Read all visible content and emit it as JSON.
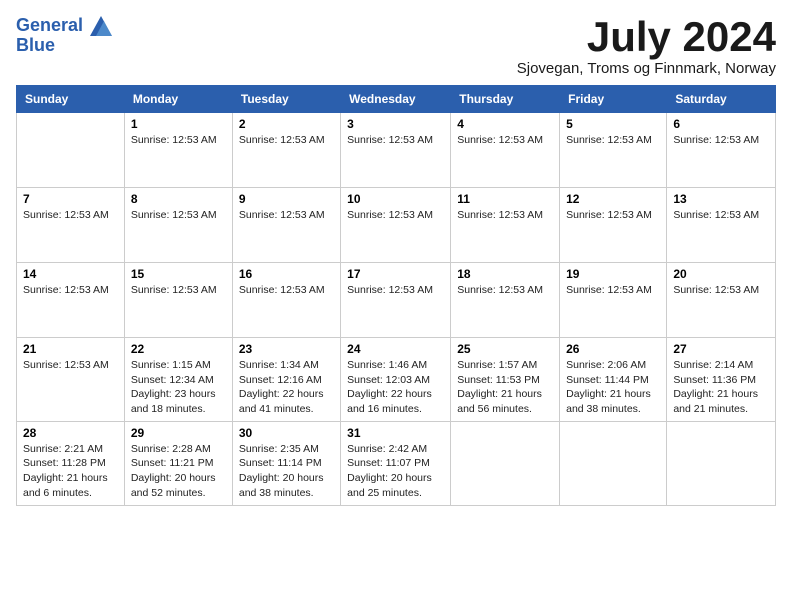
{
  "logo": {
    "line1": "General",
    "line2": "Blue"
  },
  "title": "July 2024",
  "location": "Sjovegan, Troms og Finnmark, Norway",
  "weekdays": [
    "Sunday",
    "Monday",
    "Tuesday",
    "Wednesday",
    "Thursday",
    "Friday",
    "Saturday"
  ],
  "weeks": [
    [
      {
        "day": "",
        "info": ""
      },
      {
        "day": "1",
        "info": "Sunrise: 12:53 AM"
      },
      {
        "day": "2",
        "info": "Sunrise: 12:53 AM"
      },
      {
        "day": "3",
        "info": "Sunrise: 12:53 AM"
      },
      {
        "day": "4",
        "info": "Sunrise: 12:53 AM"
      },
      {
        "day": "5",
        "info": "Sunrise: 12:53 AM"
      },
      {
        "day": "6",
        "info": "Sunrise: 12:53 AM"
      }
    ],
    [
      {
        "day": "7",
        "info": "Sunrise: 12:53 AM"
      },
      {
        "day": "8",
        "info": "Sunrise: 12:53 AM"
      },
      {
        "day": "9",
        "info": "Sunrise: 12:53 AM"
      },
      {
        "day": "10",
        "info": "Sunrise: 12:53 AM"
      },
      {
        "day": "11",
        "info": "Sunrise: 12:53 AM"
      },
      {
        "day": "12",
        "info": "Sunrise: 12:53 AM"
      },
      {
        "day": "13",
        "info": "Sunrise: 12:53 AM"
      }
    ],
    [
      {
        "day": "14",
        "info": "Sunrise: 12:53 AM"
      },
      {
        "day": "15",
        "info": "Sunrise: 12:53 AM"
      },
      {
        "day": "16",
        "info": "Sunrise: 12:53 AM"
      },
      {
        "day": "17",
        "info": "Sunrise: 12:53 AM"
      },
      {
        "day": "18",
        "info": "Sunrise: 12:53 AM"
      },
      {
        "day": "19",
        "info": "Sunrise: 12:53 AM"
      },
      {
        "day": "20",
        "info": "Sunrise: 12:53 AM"
      }
    ],
    [
      {
        "day": "21",
        "info": "Sunrise: 12:53 AM"
      },
      {
        "day": "22",
        "info": "Sunrise: 1:15 AM\nSunset: 12:34 AM\nDaylight: 23 hours and 18 minutes."
      },
      {
        "day": "23",
        "info": "Sunrise: 1:34 AM\nSunset: 12:16 AM\nDaylight: 22 hours and 41 minutes."
      },
      {
        "day": "24",
        "info": "Sunrise: 1:46 AM\nSunset: 12:03 AM\nDaylight: 22 hours and 16 minutes."
      },
      {
        "day": "25",
        "info": "Sunrise: 1:57 AM\nSunset: 11:53 PM\nDaylight: 21 hours and 56 minutes."
      },
      {
        "day": "26",
        "info": "Sunrise: 2:06 AM\nSunset: 11:44 PM\nDaylight: 21 hours and 38 minutes."
      },
      {
        "day": "27",
        "info": "Sunrise: 2:14 AM\nSunset: 11:36 PM\nDaylight: 21 hours and 21 minutes."
      }
    ],
    [
      {
        "day": "28",
        "info": "Sunrise: 2:21 AM\nSunset: 11:28 PM\nDaylight: 21 hours and 6 minutes."
      },
      {
        "day": "29",
        "info": "Sunrise: 2:28 AM\nSunset: 11:21 PM\nDaylight: 20 hours and 52 minutes."
      },
      {
        "day": "30",
        "info": "Sunrise: 2:35 AM\nSunset: 11:14 PM\nDaylight: 20 hours and 38 minutes."
      },
      {
        "day": "31",
        "info": "Sunrise: 2:42 AM\nSunset: 11:07 PM\nDaylight: 20 hours and 25 minutes."
      },
      {
        "day": "",
        "info": ""
      },
      {
        "day": "",
        "info": ""
      },
      {
        "day": "",
        "info": ""
      }
    ]
  ]
}
